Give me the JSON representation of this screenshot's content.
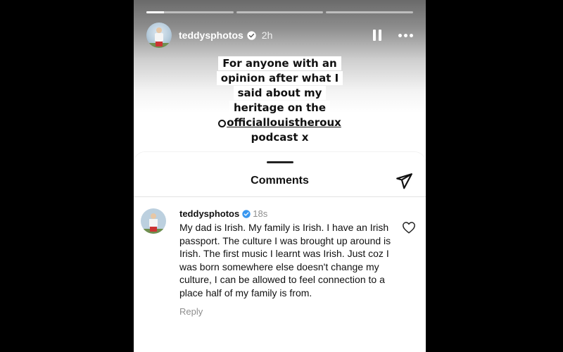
{
  "story": {
    "progress": [
      0.2,
      0,
      0
    ],
    "username": "teddysphotos",
    "time": "2h",
    "caption_lines": [
      "For anyone with an",
      "opinion after what I",
      "said about my",
      "heritage on the",
      "officiallouistheroux",
      "podcast x"
    ]
  },
  "icons": {
    "verified": "verified-badge-icon",
    "pause": "pause-icon",
    "more": "more-options-icon",
    "send": "send-icon",
    "heart": "heart-icon"
  },
  "comments_sheet": {
    "title": "Comments",
    "comment": {
      "username": "teddysphotos",
      "time": "18s",
      "text": "My dad is Irish. My family is Irish. I have an Irish passport. The culture I was brought up around is Irish. The first music I learnt was Irish. Just coz I was born somewhere else doesn't change my culture, I can be allowed to feel connection to a place half of my family is from.",
      "reply_label": "Reply"
    }
  },
  "colors": {
    "verified_blue": "#3897f0",
    "muted_text": "#8e8e8e"
  }
}
